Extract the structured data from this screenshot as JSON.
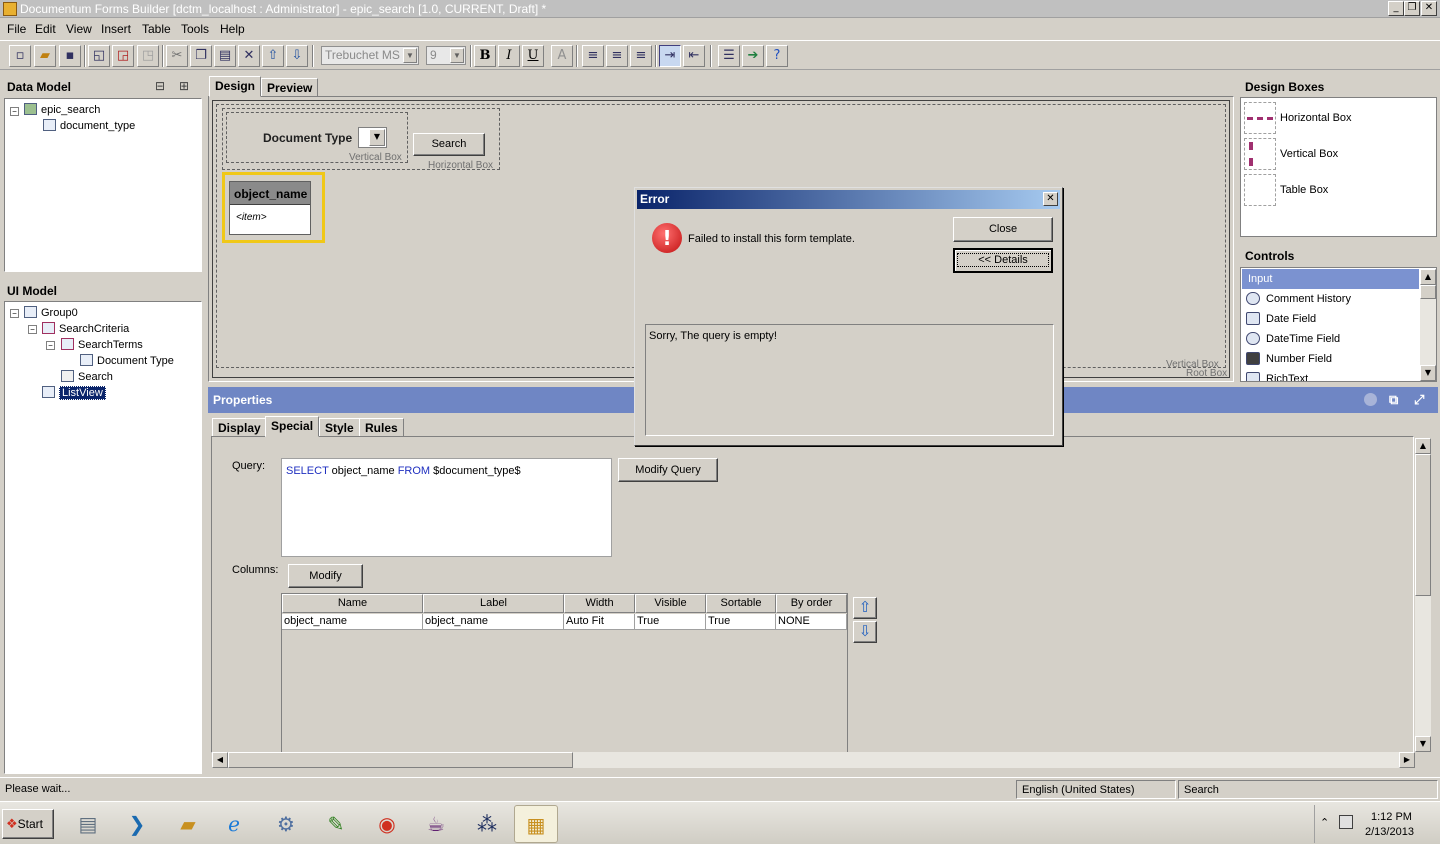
{
  "window": {
    "title": "Documentum Forms Builder [dctm_localhost : Administrator]  - epic_search [1.0, CURRENT, Draft] *",
    "min_glyph": "_",
    "restore_glyph": "❐",
    "close_glyph": "✕"
  },
  "menu": [
    "File",
    "Edit",
    "View",
    "Insert",
    "Table",
    "Tools",
    "Help"
  ],
  "toolbar": {
    "font_name": "Trebuchet MS",
    "font_size": "9",
    "bold": "B",
    "italic": "I",
    "underline": "U",
    "text_color": "A"
  },
  "data_model": {
    "title": "Data Model",
    "root": "epic_search",
    "child": "document_type"
  },
  "ui_model": {
    "title": "UI Model",
    "items": [
      "Group0",
      "SearchCriteria",
      "SearchTerms",
      "Document Type",
      "Search",
      "ListView"
    ]
  },
  "editor": {
    "tabs": [
      "Design",
      "Preview"
    ],
    "document_type_label": "Document Type",
    "search_button": "Search",
    "vertical_box_label": "Vertical Box",
    "horizontal_box_label": "Horizontal Box",
    "list_header": "object_name",
    "list_item": "<item>",
    "outer_vertical_box_label": "Vertical Box",
    "root_box_label": "Root Box"
  },
  "design_boxes": {
    "title": "Design Boxes",
    "items": [
      "Horizontal Box",
      "Vertical Box",
      "Table Box"
    ]
  },
  "controls": {
    "title": "Controls",
    "items": [
      "Input",
      "Comment History",
      "Date Field",
      "DateTime Field",
      "Number Field",
      "RichText"
    ]
  },
  "properties": {
    "title": "Properties",
    "tabs": [
      "Display",
      "Special",
      "Style",
      "Rules"
    ],
    "query_label": "Query:",
    "query_kw1": "SELECT",
    "query_part1": " object_name ",
    "query_kw2": "FROM",
    "query_part2": " $document_type$",
    "modify_query_button": "Modify Query",
    "columns_label": "Columns:",
    "modify_button": "Modify",
    "grid": {
      "headers": [
        "Name",
        "Label",
        "Width",
        "Visible",
        "Sortable",
        "By order"
      ],
      "rows": [
        [
          "object_name",
          "object_name",
          "Auto Fit",
          "True",
          "True",
          "NONE"
        ]
      ]
    }
  },
  "error_dialog": {
    "title": "Error",
    "message": "Failed to install this form template.",
    "close_button": "Close",
    "details_button": "<< Details",
    "details_text": "Sorry, The query is empty!"
  },
  "status_bar": {
    "status": "Please wait...",
    "language": "English (United States)",
    "mode": "Search"
  },
  "taskbar": {
    "start": "Start",
    "time": "1:12 PM",
    "date": "2/13/2013"
  },
  "colors": {
    "selection": "#0a246a",
    "highlight_border": "#f0c818",
    "properties_header": "#6f86c4",
    "error_icon": "#d42020"
  }
}
